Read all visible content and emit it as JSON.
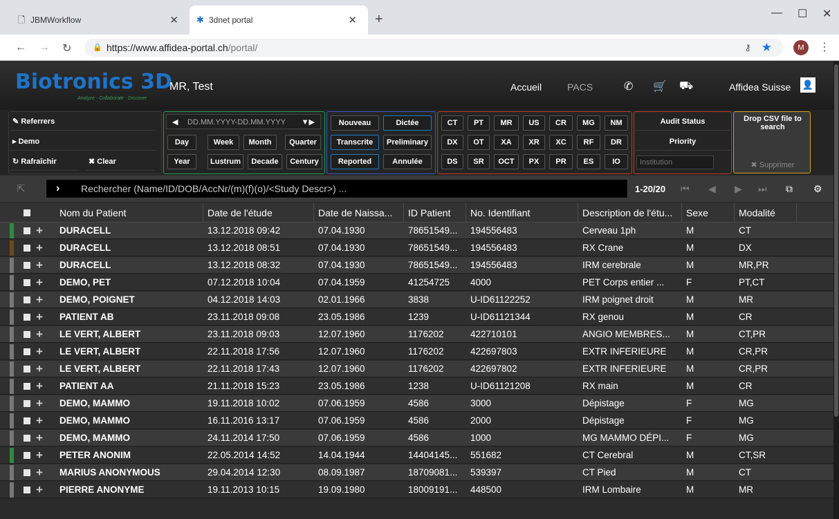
{
  "browser": {
    "tabs": [
      {
        "title": "JBMWorkflow"
      },
      {
        "title": "3dnet portal"
      }
    ],
    "url_host": "https://www.affidea-portal.ch",
    "url_path": "/portal/",
    "profile_initial": "M"
  },
  "header": {
    "logo": "Biotronics 3D",
    "tagline": "Analyze · Collaborate · Discover",
    "user": "MR, Test",
    "nav": {
      "home": "Accueil",
      "pacs": "PACS"
    },
    "org": "Affidea Suisse"
  },
  "toolbar": {
    "left": {
      "referrers": "Referrers",
      "demo": "Demo",
      "refresh": "Rafraîchir",
      "clear": "Clear"
    },
    "date_placeholder": "DD.MM.YYYY-DD.MM.YYYY",
    "periods": [
      "Day",
      "Week",
      "Month",
      "Quarter",
      "Year",
      "Lustrum",
      "Decade",
      "Century"
    ],
    "status": [
      "Nouveau",
      "Dictée",
      "Transcrite",
      "Preliminary",
      "Reported",
      "Annulée"
    ],
    "modalities": [
      "CT",
      "PT",
      "MR",
      "US",
      "CR",
      "MG",
      "NM",
      "DX",
      "OT",
      "XA",
      "XR",
      "XC",
      "RF",
      "DR",
      "DS",
      "SR",
      "OCT",
      "PX",
      "PR",
      "ES",
      "IO"
    ],
    "audit": {
      "audit_status": "Audit Status",
      "priority": "Priority",
      "institution_placeholder": "Institution"
    },
    "drop_csv": "Drop CSV file to search",
    "delete": "Supprimer"
  },
  "search": {
    "placeholder": "Rechercher (Name/ID/DOB/AccNr/(m)(f)(o)/<Study Descr>) ...",
    "page_count": "1-20/20"
  },
  "table": {
    "columns": [
      "Nom du Patient",
      "Date de l'étude",
      "Date de Naissa...",
      "ID Patient",
      "No. Identifiant",
      "Description de l'étu...",
      "Sexe",
      "Modalité"
    ],
    "rows": [
      {
        "marker": "#2e8b3d",
        "name": "DURACELL",
        "study_date": "13.12.2018 09:42",
        "dob": "07.04.1930",
        "patient_id": "78651549...",
        "ident": "194556483",
        "desc": "Cerveau 1ph",
        "sex": "M",
        "modality": "CT"
      },
      {
        "marker": "#6b4a1e",
        "name": "DURACELL",
        "study_date": "13.12.2018 08:51",
        "dob": "07.04.1930",
        "patient_id": "78651549...",
        "ident": "194556483",
        "desc": "RX Crane",
        "sex": "M",
        "modality": "DX"
      },
      {
        "marker": "#777777",
        "name": "DURACELL",
        "study_date": "13.12.2018 08:32",
        "dob": "07.04.1930",
        "patient_id": "78651549...",
        "ident": "194556483",
        "desc": "IRM cerebrale",
        "sex": "M",
        "modality": "MR,PR"
      },
      {
        "marker": "#777777",
        "name": "DEMO, PET",
        "study_date": "07.12.2018 10:04",
        "dob": "07.04.1959",
        "patient_id": "41254725",
        "ident": "4000",
        "desc": "PET Corps entier ...",
        "sex": "F",
        "modality": "PT,CT"
      },
      {
        "marker": "#777777",
        "name": "DEMO, POIGNET",
        "study_date": "04.12.2018 14:03",
        "dob": "02.01.1966",
        "patient_id": "3838",
        "ident": "U-ID61122252",
        "desc": "IRM poignet droit",
        "sex": "M",
        "modality": "MR"
      },
      {
        "marker": "#777777",
        "name": "PATIENT AB",
        "study_date": "23.11.2018 09:08",
        "dob": "23.05.1986",
        "patient_id": "1239",
        "ident": "U-ID61121344",
        "desc": "RX genou",
        "sex": "M",
        "modality": "CR"
      },
      {
        "marker": "#777777",
        "name": "LE VERT, ALBERT",
        "study_date": "23.11.2018 09:03",
        "dob": "12.07.1960",
        "patient_id": "1176202",
        "ident": "422710101",
        "desc": "ANGIO MEMBRES...",
        "sex": "M",
        "modality": "CT,PR"
      },
      {
        "marker": "#777777",
        "name": "LE VERT, ALBERT",
        "study_date": "22.11.2018 17:56",
        "dob": "12.07.1960",
        "patient_id": "1176202",
        "ident": "422697803",
        "desc": "EXTR INFERIEURE",
        "sex": "M",
        "modality": "CR,PR"
      },
      {
        "marker": "#777777",
        "name": "LE VERT, ALBERT",
        "study_date": "22.11.2018 17:43",
        "dob": "12.07.1960",
        "patient_id": "1176202",
        "ident": "422697802",
        "desc": "EXTR INFERIEURE",
        "sex": "M",
        "modality": "CR,PR"
      },
      {
        "marker": "#777777",
        "name": "PATIENT AA",
        "study_date": "21.11.2018 15:23",
        "dob": "23.05.1986",
        "patient_id": "1238",
        "ident": "U-ID61121208",
        "desc": "RX main",
        "sex": "M",
        "modality": "CR"
      },
      {
        "marker": "#777777",
        "name": "DEMO, MAMMO",
        "study_date": "19.11.2018 10:02",
        "dob": "07.06.1959",
        "patient_id": "4586",
        "ident": "3000",
        "desc": "Dépistage",
        "sex": "F",
        "modality": "MG"
      },
      {
        "marker": "#777777",
        "name": "DEMO, MAMMO",
        "study_date": "16.11.2016 13:17",
        "dob": "07.06.1959",
        "patient_id": "4586",
        "ident": "2000",
        "desc": "Dépistage",
        "sex": "F",
        "modality": "MG"
      },
      {
        "marker": "#777777",
        "name": "DEMO, MAMMO",
        "study_date": "24.11.2014 17:50",
        "dob": "07.06.1959",
        "patient_id": "4586",
        "ident": "1000",
        "desc": "MG MAMMO DÉPI...",
        "sex": "F",
        "modality": "MG"
      },
      {
        "marker": "#2e8b3d",
        "name": "PETER ANONIM",
        "study_date": "22.05.2014 14:52",
        "dob": "14.04.1944",
        "patient_id": "14404145...",
        "ident": "551682",
        "desc": "CT Cerebral",
        "sex": "M",
        "modality": "CT,SR"
      },
      {
        "marker": "#777777",
        "name": "MARIUS ANONYMOUS",
        "study_date": "29.04.2014 12:30",
        "dob": "08.09.1987",
        "patient_id": "18709081...",
        "ident": "539397",
        "desc": "CT Pied",
        "sex": "M",
        "modality": "CT"
      },
      {
        "marker": "#777777",
        "name": "PIERRE ANONYME",
        "study_date": "19.11.2013 10:15",
        "dob": "19.09.1980",
        "patient_id": "18009191...",
        "ident": "448500",
        "desc": "IRM Lombaire",
        "sex": "M",
        "modality": "MR"
      }
    ]
  },
  "colors": {
    "accent": "#1e73c8",
    "group_green": "#1f9d55",
    "group_blue": "#3a56c8",
    "group_red": "#c0392b",
    "group_orange": "#d4a017"
  }
}
